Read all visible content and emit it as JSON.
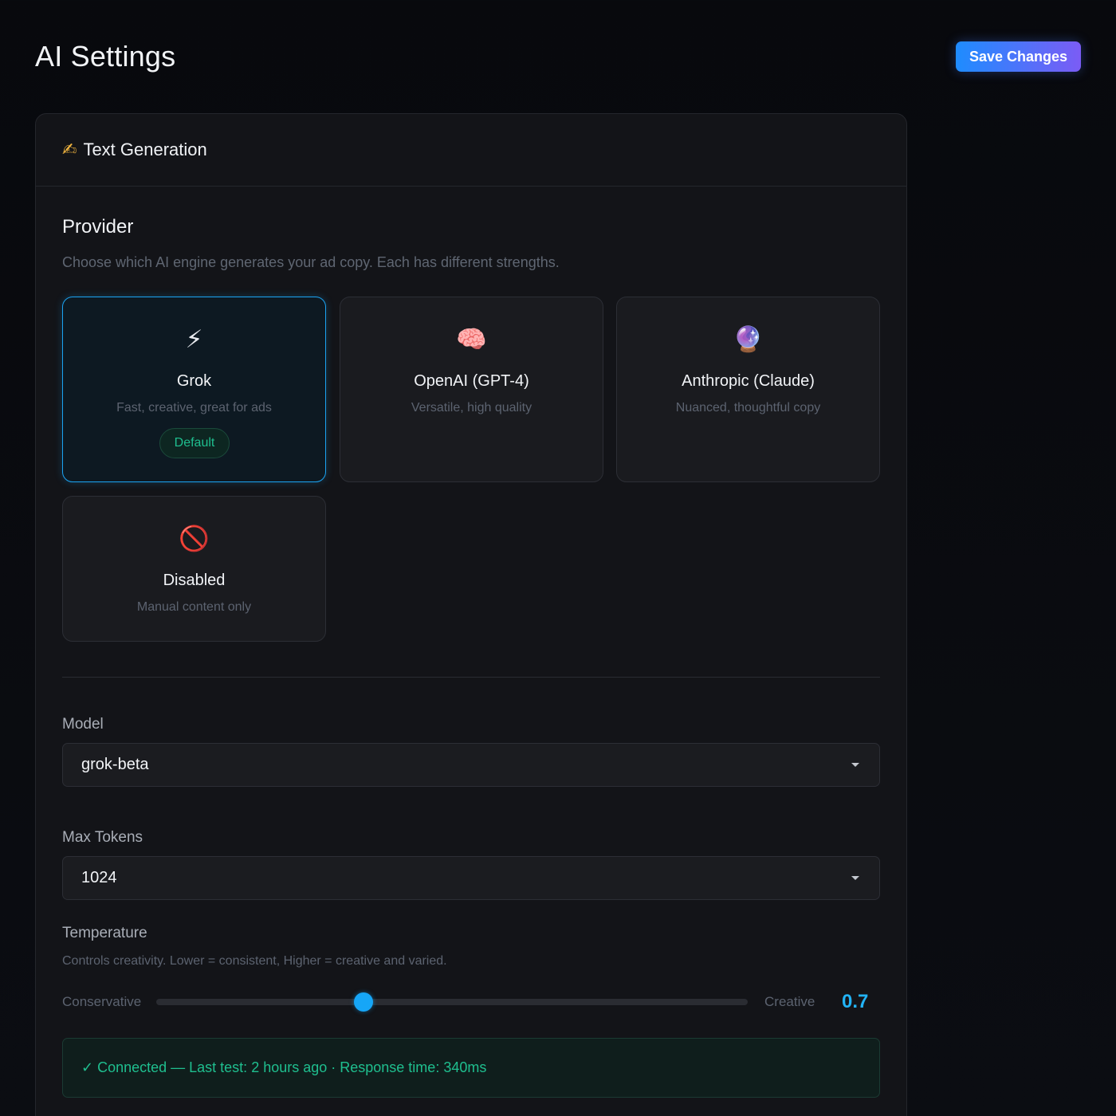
{
  "header": {
    "title": "AI Settings",
    "save_label": "Save Changes"
  },
  "panel": {
    "icon": "writing-hand-icon",
    "icon_glyph": "✍",
    "title": "Text Generation",
    "provider": {
      "title": "Provider",
      "description": "Choose which AI engine generates your ad copy. Each has different strengths.",
      "selected": "Grok",
      "options": [
        {
          "name": "Grok",
          "icon": "lightning-icon",
          "glyph": "⚡",
          "desc": "Fast, creative, great for ads",
          "badge": "Default"
        },
        {
          "name": "OpenAI (GPT-4)",
          "icon": "brain-icon",
          "glyph": "🧠",
          "desc": "Versatile, high quality"
        },
        {
          "name": "Anthropic (Claude)",
          "icon": "crystal-ball-icon",
          "glyph": "🔮",
          "desc": "Nuanced, thoughtful copy"
        },
        {
          "name": "Disabled",
          "icon": "prohibited-icon",
          "glyph": "🚫",
          "desc": "Manual content only"
        }
      ]
    },
    "model": {
      "label": "Model",
      "value": "grok-beta"
    },
    "max_tokens": {
      "label": "Max Tokens",
      "value": "1024"
    },
    "temperature": {
      "label": "Temperature",
      "description": "Controls creativity. Lower = consistent, Higher = creative and varied.",
      "min_label": "Conservative",
      "max_label": "Creative",
      "value": "0.7",
      "level": 0.35
    },
    "status": {
      "text": "✓ Connected — Last test: 2 hours ago · Response time: 340ms"
    }
  },
  "colors": {
    "accent": "#1ba3f2",
    "success": "#1fbf8f",
    "button_gradient_start": "#1e8cff",
    "button_gradient_end": "#7b5cf5"
  }
}
